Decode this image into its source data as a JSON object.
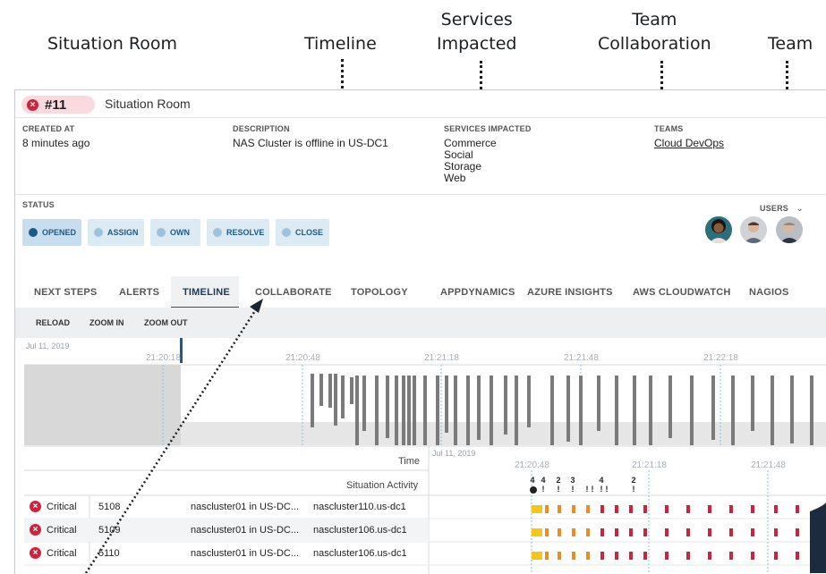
{
  "callouts": {
    "situation_room": "Situation Room",
    "timeline": "Timeline",
    "services_impacted_1": "Services",
    "services_impacted_2": "Impacted",
    "team_collab_1": "Team",
    "team_collab_2": "Collaboration",
    "team": "Team"
  },
  "header": {
    "id": "#11",
    "title": "Situation Room"
  },
  "fields": {
    "created_label": "CREATED AT",
    "created_value": "8 minutes ago",
    "description_label": "DESCRIPTION",
    "description_value": "NAS Cluster is offline in US-DC1",
    "services_label": "SERVICES IMPACTED",
    "services": [
      "Commerce",
      "Social",
      "Storage",
      "Web"
    ],
    "teams_label": "TEAMS",
    "team_value": "Cloud DevOps"
  },
  "status": {
    "label": "STATUS",
    "users_label": "USERS",
    "buttons": [
      "OPENED",
      "ASSIGN",
      "OWN",
      "RESOLVE",
      "CLOSE"
    ]
  },
  "tabs": [
    "NEXT STEPS",
    "ALERTS",
    "TIMELINE",
    "COLLABORATE",
    "TOPOLOGY",
    "APPDYNAMICS",
    "AZURE INSIGHTS",
    "AWS CLOUDWATCH",
    "NAGIOS"
  ],
  "toolbar": [
    "RELOAD",
    "ZOOM IN",
    "ZOOM OUT"
  ],
  "timeline": {
    "date": "Jul 11, 2019",
    "ticks": [
      "21:20:18",
      "21:20:48",
      "21:21:18",
      "21:21:48",
      "21:22:18"
    ],
    "lower_ticks": [
      "21:20:48",
      "21:21:18",
      "21:21:48"
    ],
    "time_label": "Time",
    "activity_label": "Situation Activity",
    "activity_counts": [
      "4",
      "4",
      "2",
      "3",
      "4",
      "2"
    ]
  },
  "rows": [
    {
      "severity": "Critical",
      "id": "5108",
      "desc": "nascluster01 in US-DC...",
      "host": "nascluster110.us-dc1"
    },
    {
      "severity": "Critical",
      "id": "5109",
      "desc": "nascluster01 in US-DC...",
      "host": "nascluster106.us-dc1"
    },
    {
      "severity": "Critical",
      "id": "5110",
      "desc": "nascluster01 in US-DC...",
      "host": "nascluster106.us-dc1"
    }
  ],
  "colors": {
    "accent": "#1f5a86",
    "critical": "#d1223b",
    "warn_yellow": "#f5c518",
    "warn_orange": "#f08c1e"
  }
}
